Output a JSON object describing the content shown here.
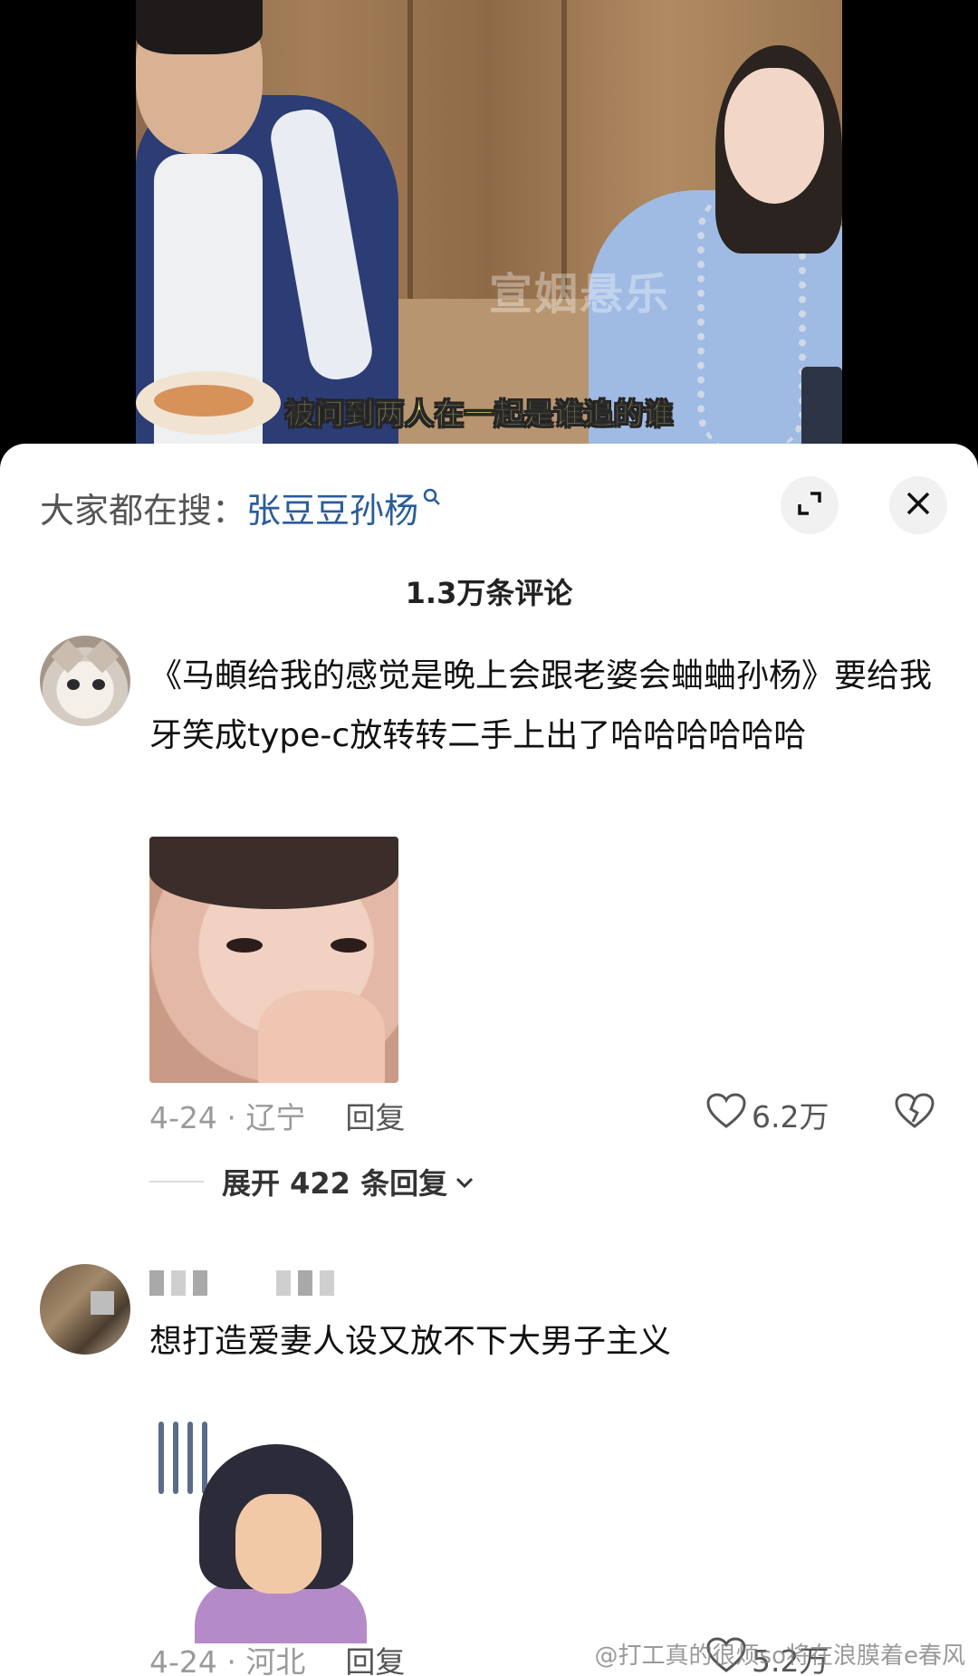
{
  "video": {
    "subtitle": "被问到两人在一起是谁追的谁",
    "watermark": "宣姻悬乐"
  },
  "search": {
    "prefix": "大家都在搜：",
    "term": "张豆豆孙杨"
  },
  "comments_header": {
    "count_label": "1.3万条评论"
  },
  "comments": [
    {
      "text": "《马頔给我的感觉是晚上会跟老婆会蛐蛐孙杨》要给我牙笑成type-c放转转二手上出了哈哈哈哈哈哈",
      "date_location": "4-24 · 辽宁",
      "reply_label": "回复",
      "likes": "6.2万",
      "expand_label": "展开 422 条回复"
    },
    {
      "text": "想打造爱妻人设又放不下大男子主义",
      "date_location": "4-24 · 河北",
      "reply_label": "回复",
      "likes": "5.2万"
    }
  ],
  "footer": {
    "watermark": "@打工真的很烦so将在浪膜着e春风"
  },
  "icons": {
    "search": "search-icon",
    "collapse": "collapse-icon",
    "close": "close-icon",
    "like": "heart-icon",
    "dislike": "broken-heart-icon",
    "expand": "chevron-down-icon"
  }
}
